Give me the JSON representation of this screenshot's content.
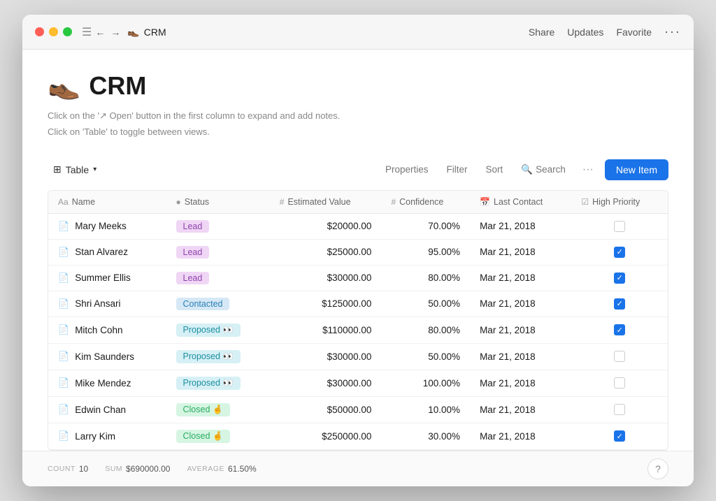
{
  "titlebar": {
    "menu_icon": "☰",
    "nav_back": "←",
    "nav_forward": "→",
    "app_emoji": "👞",
    "app_name": "CRM",
    "actions": [
      "Share",
      "Updates",
      "Favorite"
    ],
    "more": "···"
  },
  "page": {
    "emoji": "👞",
    "title": "CRM",
    "description_line1": "Click on the '↗ Open' button in the first column to expand and add notes.",
    "description_line2": "Click on 'Table' to toggle between views."
  },
  "toolbar": {
    "view_label": "Table",
    "view_chevron": "∨",
    "properties": "Properties",
    "filter": "Filter",
    "sort": "Sort",
    "search_icon": "🔍",
    "search_label": "Search",
    "more": "···",
    "new_item": "New Item"
  },
  "table": {
    "columns": [
      {
        "id": "name",
        "icon": "Aa",
        "label": "Name"
      },
      {
        "id": "status",
        "icon": "●",
        "label": "Status"
      },
      {
        "id": "value",
        "icon": "#",
        "label": "Estimated Value"
      },
      {
        "id": "confidence",
        "icon": "#",
        "label": "Confidence"
      },
      {
        "id": "last_contact",
        "icon": "📅",
        "label": "Last Contact"
      },
      {
        "id": "high_priority",
        "icon": "☑",
        "label": "High Priority"
      }
    ],
    "rows": [
      {
        "name": "Mary Meeks",
        "status": "Lead",
        "status_type": "lead",
        "value": "$20000.00",
        "confidence": "70.00%",
        "last_contact": "Mar 21, 2018",
        "high_priority": false
      },
      {
        "name": "Stan Alvarez",
        "status": "Lead",
        "status_type": "lead",
        "value": "$25000.00",
        "confidence": "95.00%",
        "last_contact": "Mar 21, 2018",
        "high_priority": true
      },
      {
        "name": "Summer Ellis",
        "status": "Lead",
        "status_type": "lead",
        "value": "$30000.00",
        "confidence": "80.00%",
        "last_contact": "Mar 21, 2018",
        "high_priority": true
      },
      {
        "name": "Shri Ansari",
        "status": "Contacted",
        "status_type": "contacted",
        "value": "$125000.00",
        "confidence": "50.00%",
        "last_contact": "Mar 21, 2018",
        "high_priority": true
      },
      {
        "name": "Mitch Cohn",
        "status": "Proposed 👀",
        "status_type": "proposed",
        "value": "$110000.00",
        "confidence": "80.00%",
        "last_contact": "Mar 21, 2018",
        "high_priority": true
      },
      {
        "name": "Kim Saunders",
        "status": "Proposed 👀",
        "status_type": "proposed",
        "value": "$30000.00",
        "confidence": "50.00%",
        "last_contact": "Mar 21, 2018",
        "high_priority": false
      },
      {
        "name": "Mike Mendez",
        "status": "Proposed 👀",
        "status_type": "proposed",
        "value": "$30000.00",
        "confidence": "100.00%",
        "last_contact": "Mar 21, 2018",
        "high_priority": false
      },
      {
        "name": "Edwin Chan",
        "status": "Closed 🤞",
        "status_type": "closed",
        "value": "$50000.00",
        "confidence": "10.00%",
        "last_contact": "Mar 21, 2018",
        "high_priority": false
      },
      {
        "name": "Larry Kim",
        "status": "Closed 🤞",
        "status_type": "closed",
        "value": "$250000.00",
        "confidence": "30.00%",
        "last_contact": "Mar 21, 2018",
        "high_priority": true
      }
    ]
  },
  "footer": {
    "count_label": "COUNT",
    "count_value": "10",
    "sum_label": "SUM",
    "sum_value": "$690000.00",
    "avg_label": "AVERAGE",
    "avg_value": "61.50%",
    "help": "?"
  }
}
